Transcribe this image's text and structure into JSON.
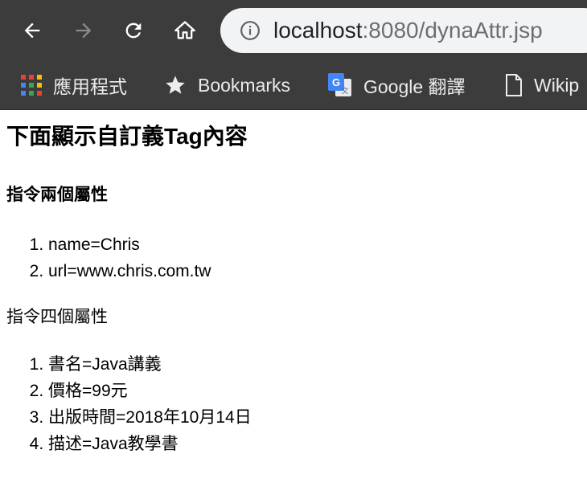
{
  "browser": {
    "url_host": "localhost",
    "url_path": ":8080/dynaAttr.jsp",
    "bookmarks": [
      {
        "label": "應用程式",
        "icon": "apps-grid-icon"
      },
      {
        "label": "Bookmarks",
        "icon": "star-icon"
      },
      {
        "label": "Google 翻譯",
        "icon": "google-translate-icon"
      },
      {
        "label": "Wikip",
        "icon": "page-icon"
      }
    ]
  },
  "page": {
    "title": "下面顯示自訂義Tag內容",
    "section1": {
      "heading": "指令兩個屬性",
      "items": [
        "name=Chris",
        "url=www.chris.com.tw"
      ]
    },
    "section2": {
      "heading": "指令四個屬性",
      "items": [
        "書名=Java講義",
        "價格=99元",
        "出版時間=2018年10月14日",
        "描述=Java教學書"
      ]
    }
  }
}
